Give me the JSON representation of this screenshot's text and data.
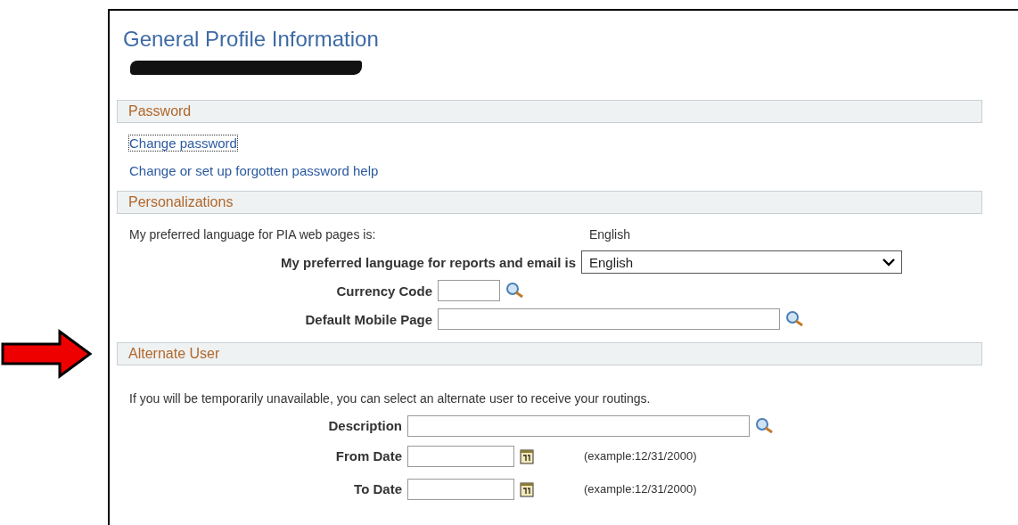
{
  "title": "General Profile Information",
  "sections": [
    {
      "kind": "links",
      "header": "Password",
      "pointed_at": false,
      "links": [
        {
          "text": "Change password",
          "focused": true
        },
        {
          "text": "Change or set up forgotten password help",
          "focused": false
        }
      ]
    },
    {
      "kind": "form",
      "header": "Personalizations",
      "pointed_at": false,
      "intro": {
        "label": "My preferred language for PIA web pages is:",
        "value": "English"
      },
      "fields": [
        {
          "kind": "select",
          "label": "My preferred language for reports and email is",
          "value": "English"
        },
        {
          "kind": "short-lookup",
          "label": "Currency Code"
        },
        {
          "kind": "lookup",
          "label": "Default Mobile Page"
        }
      ]
    },
    {
      "kind": "form",
      "header": "Alternate User",
      "pointed_at": true,
      "note": "If you will be temporarily unavailable, you can select an alternate user to receive your routings.",
      "fields": [
        {
          "kind": "lookup",
          "label": "Description"
        },
        {
          "kind": "date",
          "label": "From Date",
          "hint": "(example:12/31/2000)"
        },
        {
          "kind": "date",
          "label": "To Date",
          "hint": "(example:12/31/2000)"
        }
      ]
    }
  ]
}
